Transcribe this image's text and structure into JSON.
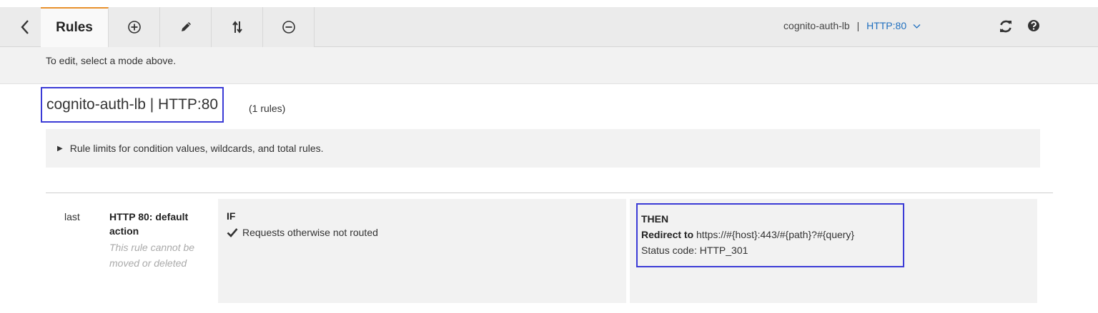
{
  "toolbar": {
    "back_icon": "chevron-left-icon",
    "tab_rules_label": "Rules",
    "icons": [
      "plus-circle-icon",
      "pencil-icon",
      "reorder-icon",
      "minus-circle-icon",
      "refresh-icon",
      "help-icon"
    ],
    "lb_name": "cognito-auth-lb",
    "separator": "|",
    "listener": "HTTP:80",
    "accent_color": "#e8912c",
    "link_color": "#1f6fbf"
  },
  "mode_message": "To edit, select a mode above.",
  "heading": {
    "title": "cognito-auth-lb | HTTP:80",
    "count": "(1 rules)",
    "highlight_color": "#3b3bd6"
  },
  "limits_text": "Rule limits for condition values, wildcards, and total rules.",
  "rule": {
    "position": "last",
    "name": "HTTP 80: default action",
    "note": "This rule cannot be moved or deleted",
    "if_label": "IF",
    "condition": "Requests otherwise not routed",
    "then_label": "THEN",
    "action_label": "Redirect to",
    "redirect_url": "https://#{host}:443/#{path}?#{query}",
    "status_line": "Status code: HTTP_301"
  }
}
